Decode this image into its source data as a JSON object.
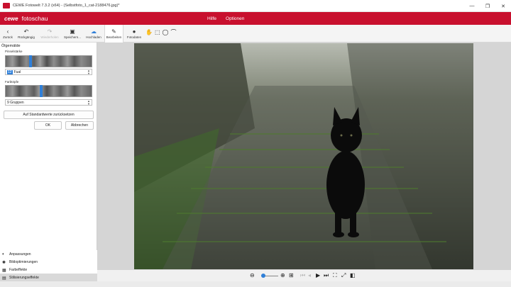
{
  "window": {
    "title": "CEWE Fotowelt 7.3.2 (x64) - (Selbstfoto_1_cat-2188476.jpg)*",
    "controls": [
      "—",
      "❐",
      "✕"
    ]
  },
  "brand": {
    "logo": "cewe",
    "name": "fotoschau"
  },
  "menu": {
    "help": "Hilfe",
    "options": "Optionen"
  },
  "toolbar": {
    "back": "Zurück",
    "undo": "Rückgängig",
    "redo": "Wiederholen",
    "save": "Speichern...",
    "upload": "Hochladen",
    "edit": "Bearbeiten",
    "photodata": "Fotodaten"
  },
  "panel": {
    "title": "Ölgemälde",
    "pixel_size_label": "Pinselstärke",
    "pixel_size_value": "Fual",
    "pixel_size_highlight": "12",
    "color_label": "Farbtöpfe",
    "color_value": "9 Gruppen",
    "reset_button": "Auf Standardwerte zurücksetzen",
    "ok_button": "OK",
    "cancel_button": "Abbrechen"
  },
  "sections": {
    "adjustments": "Anpassungen",
    "optimization": "Bildoptimierungen",
    "color_effects": "Farbeffekte",
    "style_effects": "Stilisierungseffekte"
  },
  "colors": {
    "accent": "#c8102e",
    "selection": "#2f7fd8"
  }
}
